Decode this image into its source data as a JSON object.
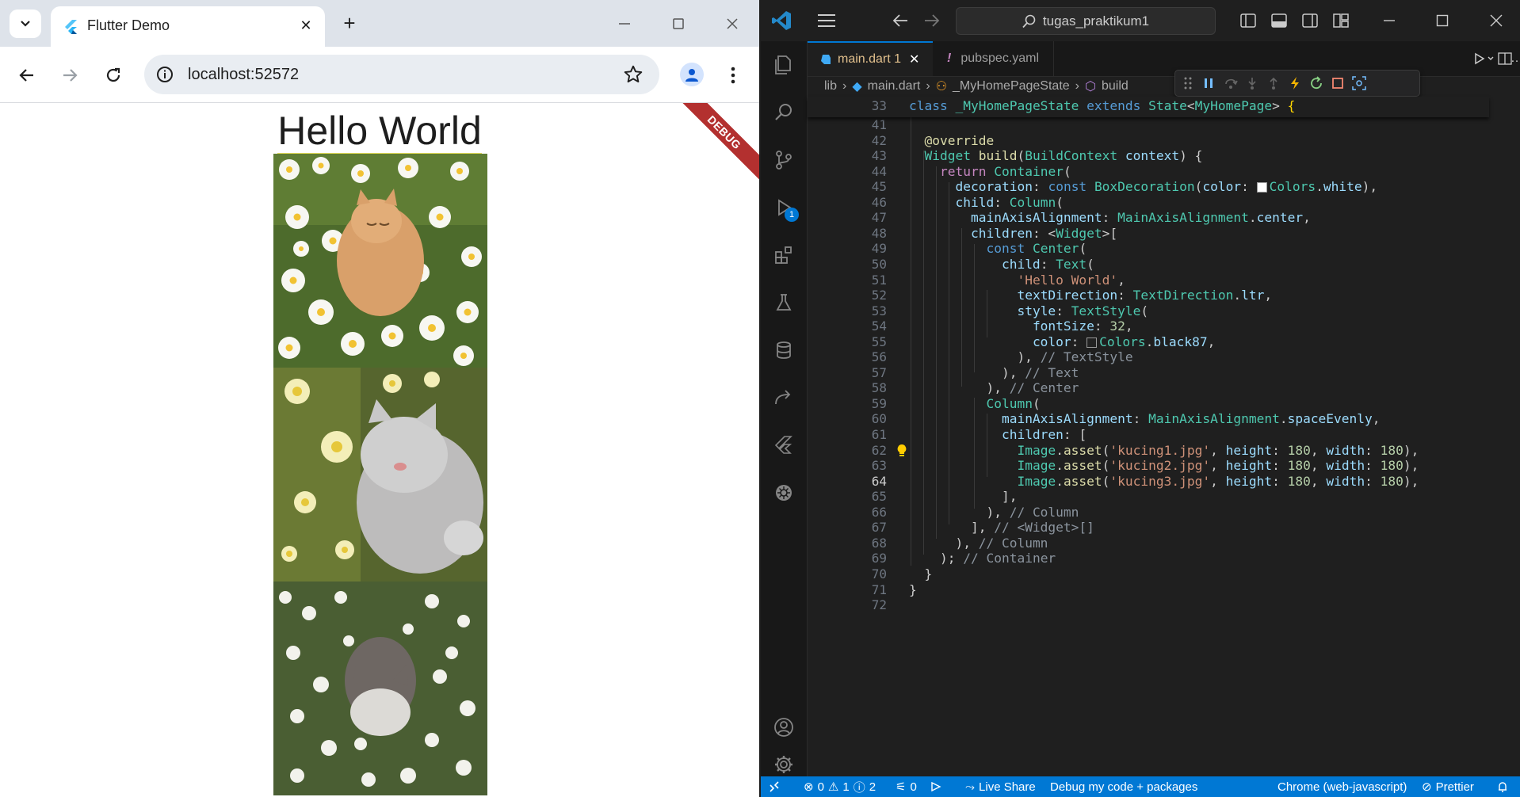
{
  "browser": {
    "tab_title": "Flutter Demo",
    "url": "localhost:52572"
  },
  "app": {
    "heading": "Hello World",
    "debug_banner": "DEBUG",
    "images": [
      {
        "alt": "kucing1.jpg",
        "desc": "orange cat among daisies"
      },
      {
        "alt": "kucing2.jpg",
        "desc": "grey cat lying in flowers"
      },
      {
        "alt": "kucing3.jpg",
        "desc": "grey white cat in white flowers"
      }
    ]
  },
  "vscode": {
    "search_text": "tugas_praktikum1",
    "tabs": [
      {
        "label": "main.dart 1",
        "icon": "dart-icon",
        "active": true
      },
      {
        "label": "pubspec.yaml",
        "icon": "yaml-icon",
        "active": false
      }
    ],
    "breadcrumbs": [
      "lib",
      "main.dart",
      "_MyHomePageState",
      "build"
    ],
    "sticky_line": {
      "num": "33",
      "text": "class _MyHomePageState extends State<MyHomePage> {"
    },
    "current_line": "64",
    "code_lines": [
      {
        "num": "41",
        "text": ""
      },
      {
        "num": "42",
        "text": "  @override"
      },
      {
        "num": "43",
        "text": "  Widget build(BuildContext context) {"
      },
      {
        "num": "44",
        "text": "    return Container("
      },
      {
        "num": "45",
        "text": "      decoration: const BoxDecoration(color: Colors.white),"
      },
      {
        "num": "46",
        "text": "      child: Column("
      },
      {
        "num": "47",
        "text": "        mainAxisAlignment: MainAxisAlignment.center,"
      },
      {
        "num": "48",
        "text": "        children: <Widget>["
      },
      {
        "num": "49",
        "text": "          const Center("
      },
      {
        "num": "50",
        "text": "            child: Text("
      },
      {
        "num": "51",
        "text": "              'Hello World',"
      },
      {
        "num": "52",
        "text": "              textDirection: TextDirection.ltr,"
      },
      {
        "num": "53",
        "text": "              style: TextStyle("
      },
      {
        "num": "54",
        "text": "                fontSize: 32,"
      },
      {
        "num": "55",
        "text": "                color: Colors.black87,"
      },
      {
        "num": "56",
        "text": "              ), // TextStyle"
      },
      {
        "num": "57",
        "text": "            ), // Text"
      },
      {
        "num": "58",
        "text": "          ), // Center"
      },
      {
        "num": "59",
        "text": "          Column("
      },
      {
        "num": "60",
        "text": "            mainAxisAlignment: MainAxisAlignment.spaceEvenly,"
      },
      {
        "num": "61",
        "text": "            children: ["
      },
      {
        "num": "62",
        "text": "              Image.asset('kucing1.jpg', height: 180, width: 180),"
      },
      {
        "num": "63",
        "text": "              Image.asset('kucing2.jpg', height: 180, width: 180),"
      },
      {
        "num": "64",
        "text": "              Image.asset('kucing3.jpg', height: 180, width: 180),"
      },
      {
        "num": "65",
        "text": "            ],"
      },
      {
        "num": "66",
        "text": "          ), // Column"
      },
      {
        "num": "67",
        "text": "        ], // <Widget>[]"
      },
      {
        "num": "68",
        "text": "      ), // Column"
      },
      {
        "num": "69",
        "text": "    ); // Container"
      },
      {
        "num": "70",
        "text": "  }"
      },
      {
        "num": "71",
        "text": "}"
      },
      {
        "num": "72",
        "text": ""
      }
    ],
    "status": {
      "errors": "0",
      "warnings": "1",
      "infos": "2",
      "ports": "0",
      "live_share": "Live Share",
      "debug_config": "Debug my code + packages",
      "device": "Chrome (web-javascript)",
      "prettier": "Prettier"
    },
    "debug_badge": "1"
  },
  "colors": {
    "vscode_accent": "#0078d4",
    "debug_banner": "#b3302f"
  }
}
